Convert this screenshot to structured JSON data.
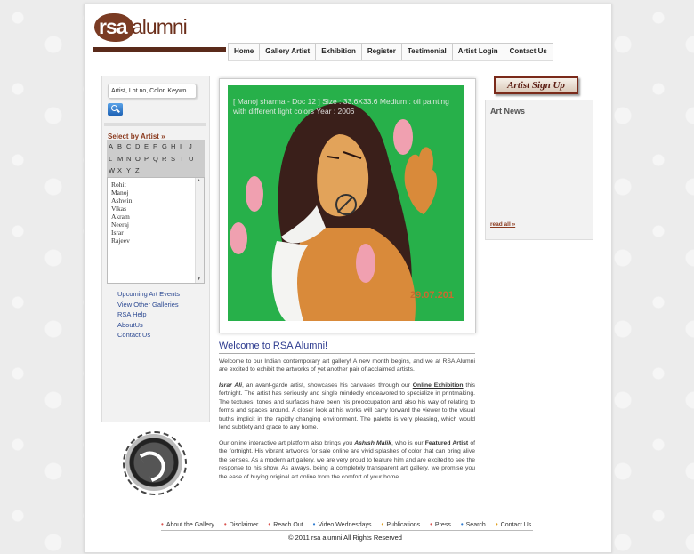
{
  "logo": {
    "text1": "rsa",
    "text2": "alumni"
  },
  "nav": [
    "Home",
    "Gallery Artist",
    "Exhibition",
    "Register",
    "Testimonial",
    "Artist Login",
    "Contact Us"
  ],
  "search": {
    "placeholder": "Artist, Lot no, Color, Keywo"
  },
  "select_title": "Select by Artist »",
  "alphabet": [
    "A",
    "B",
    "C",
    "D",
    "E",
    "F",
    "G",
    "H",
    "I",
    "J",
    "L",
    "M",
    "N",
    "O",
    "P",
    "Q",
    "R",
    "S",
    "T",
    "U",
    "W",
    "X",
    "Y",
    "Z"
  ],
  "artists": [
    "Rohit",
    "Manoj",
    "Ashwin",
    "Vikas",
    "Akram",
    "Neeraj",
    "Israr",
    "Rajeev"
  ],
  "side_links": [
    "Upcoming Art Events",
    "View Other Galleries",
    "RSA Help",
    "AboutUs",
    "Contact Us"
  ],
  "painting": {
    "caption": "[ Manoj sharma - Doc 12 ] Size : 33.6X33.6 Medium : oil painting with different light colors Year : 2006",
    "date": "29.07.201"
  },
  "welcome": {
    "title": "Welcome to RSA Alumni!",
    "p1": "Welcome to our Indian contemporary art gallery! A new month begins, and we at RSA Alumni are excited to exhibit the artworks of yet another pair of acclaimed artists.",
    "p2_name": "Israr Ali",
    "p2_a": ", an avant-garde artist, showcases his canvases through our ",
    "p2_link": "Online Exhibition",
    "p2_b": " this fortnight. The artist has seriously and single mindedly endeavored to specialize in printmaking. The textures, tones and surfaces have been his preoccupation and also his way of relating to forms and spaces around. A closer look at his works will carry forward the viewer to the visual truths implicit in the rapidly changing environment. The palette is very pleasing, which would lend subtlety and grace to any home.",
    "p3_a": "Our online interactive art platform also brings you ",
    "p3_name": "Ashish Malik",
    "p3_b": ", who is our ",
    "p3_link": "Featured Artist",
    "p3_c": " of the fortnight. His vibrant artworks for sale online are vivid splashes of color that can bring alive the senses. As a modern art gallery, we are very proud to feature him and are excited to see the response to his show. As always, being a completely transparent art gallery, we promise you the ease of buying original art online from the comfort of your home."
  },
  "signup": "Artist Sign Up",
  "news": {
    "title": "Art News",
    "read_all": "read all »"
  },
  "footer": {
    "links": [
      {
        "label": "About the Gallery",
        "color": "#d9534f"
      },
      {
        "label": "Disclaimer",
        "color": "#d9534f"
      },
      {
        "label": "Reach Out",
        "color": "#d9534f"
      },
      {
        "label": "Video Wednesdays",
        "color": "#2e7bd0"
      },
      {
        "label": "Publications",
        "color": "#e0a020"
      },
      {
        "label": "Press",
        "color": "#d9534f"
      },
      {
        "label": "Search",
        "color": "#2e7bd0"
      },
      {
        "label": "Contact Us",
        "color": "#e0a020"
      }
    ],
    "copyright": "© 2011  rsa alumni All Rights Reserved"
  }
}
